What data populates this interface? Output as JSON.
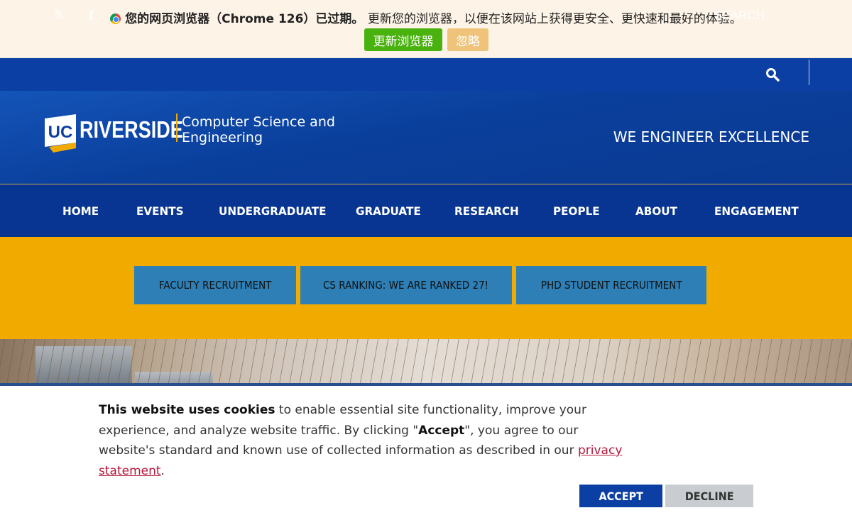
{
  "browser_update": {
    "icon": "chrome-icon",
    "bold_text": "您的网页浏览器（Chrome 126）已过期。",
    "message": "更新您的浏览器，以便在该网站上获得更安全、更快速和最好的体验。",
    "update_label": "更新浏览器",
    "ignore_label": "忽略"
  },
  "topbar": {
    "social": [
      {
        "icon": "x-twitter-icon",
        "glyph": "𝕏"
      },
      {
        "icon": "facebook-icon",
        "glyph": "f"
      }
    ],
    "search_label": "SEARCH"
  },
  "header": {
    "logo_uc": "UC",
    "logo_word": "RIVERSIDE",
    "dept_line1": "Computer Science and",
    "dept_line2": "Engineering",
    "tagline": "WE ENGINEER EXCELLENCE"
  },
  "nav": {
    "items": [
      "HOME",
      "EVENTS",
      "UNDERGRADUATE",
      "GRADUATE",
      "RESEARCH",
      "PEOPLE",
      "ABOUT",
      "ENGAGEMENT"
    ]
  },
  "quick_links": [
    "FACULTY RECRUITMENT",
    "CS RANKING: WE ARE RANKED 27!",
    "PHD STUDENT RECRUITMENT"
  ],
  "cookie": {
    "bold_intro": "This website uses cookies",
    "text1": " to enable essential site functionality, improve your experience, and analyze website traffic. By clicking \"",
    "bold_accept": "Accept",
    "text2": "\", you agree to our website's standard and known use of collected information as described in our ",
    "link_text": "privacy statement",
    "text3": ".",
    "accept_label": "ACCEPT",
    "decline_label": "DECLINE"
  },
  "colors": {
    "brand_blue": "#0b3fa3",
    "gold": "#f1ab00",
    "quick_link_blue": "#2d7fb5",
    "update_green": "#49b20f"
  }
}
